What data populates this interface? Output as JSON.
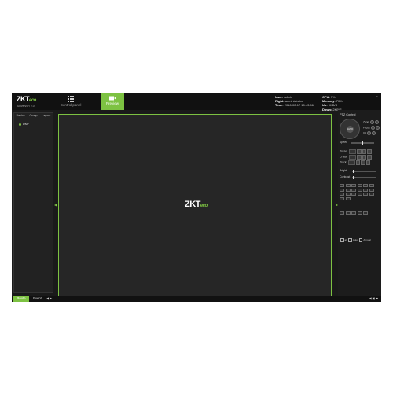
{
  "brand": {
    "name": "ZKT",
    "name_suffix": "eco",
    "version": "ActiveNVR 2.0"
  },
  "nav": {
    "control_panel": "Control panel",
    "preview": "Preview"
  },
  "status": {
    "user_label": "User:",
    "user_value": "admin",
    "right_label": "Right:",
    "right_value": "administrator",
    "time_label": "Time:",
    "time_value": "2016-02-17 15:43:56",
    "cpu_label": "CPU:",
    "cpu_value": "7%",
    "memory_label": "Memory:",
    "memory_value": "70%",
    "up_label": "Up:",
    "up_value": "9KB/S",
    "down_label": "Down:",
    "down_value": "2KB/S"
  },
  "left_tabs": [
    "Device",
    "Group",
    "Layout"
  ],
  "tree": {
    "item": "DMF"
  },
  "viewport_logo": {
    "name": "ZKT",
    "suffix": "eco"
  },
  "ptz": {
    "title": "PTZ Control",
    "dial_center": "AUTO",
    "zoom": "Zoom",
    "focus": "Focus",
    "iris": "Iris",
    "speed": "Speed",
    "preset": "Preset",
    "cruise": "Cruise",
    "track": "Track",
    "bright": "Bright",
    "contrast": "Contrast",
    "check_all": "all",
    "check_auto": "Auto",
    "check_annual": "Annual"
  },
  "bottom": {
    "route": "Route",
    "event": "Event"
  },
  "colors": {
    "accent": "#7dc242",
    "background": "#1a1a1a"
  }
}
